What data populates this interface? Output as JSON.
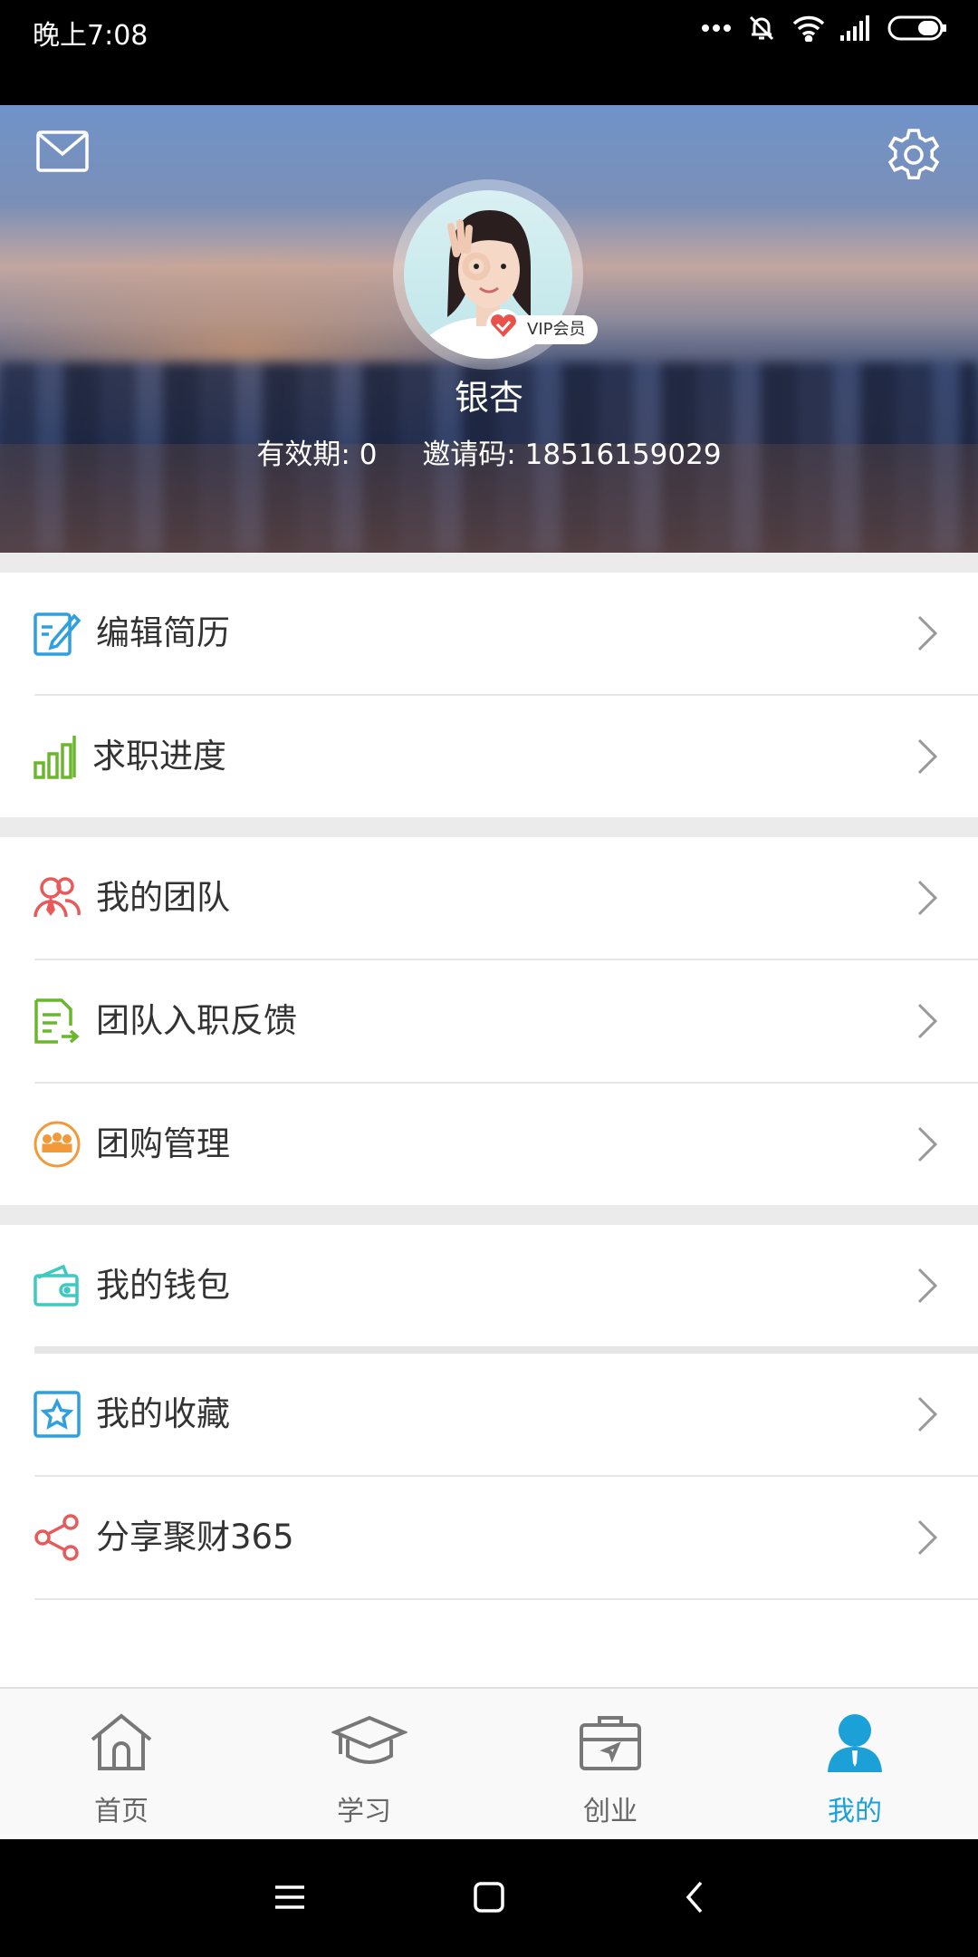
{
  "status_bar": {
    "time": "晚上7:08"
  },
  "profile": {
    "name": "银杏",
    "vip_label": "VIP会员",
    "validity": "有效期: 0",
    "invite_code": "邀请码: 18516159029"
  },
  "menu": {
    "edit_resume": "编辑简历",
    "job_progress": "求职进度",
    "my_team": "我的团队",
    "team_feedback": "团队入职反馈",
    "group_buy": "团购管理",
    "my_wallet": "我的钱包",
    "my_favorites": "我的收藏",
    "share": "分享聚财365"
  },
  "tabs": {
    "home": "首页",
    "study": "学习",
    "startup": "创业",
    "mine": "我的"
  },
  "colors": {
    "accent": "#1ba0d8",
    "green": "#6ab72d",
    "red": "#e85a5a",
    "orange": "#f29a3a",
    "teal": "#3fc9c0",
    "blue": "#2f9fe0"
  }
}
